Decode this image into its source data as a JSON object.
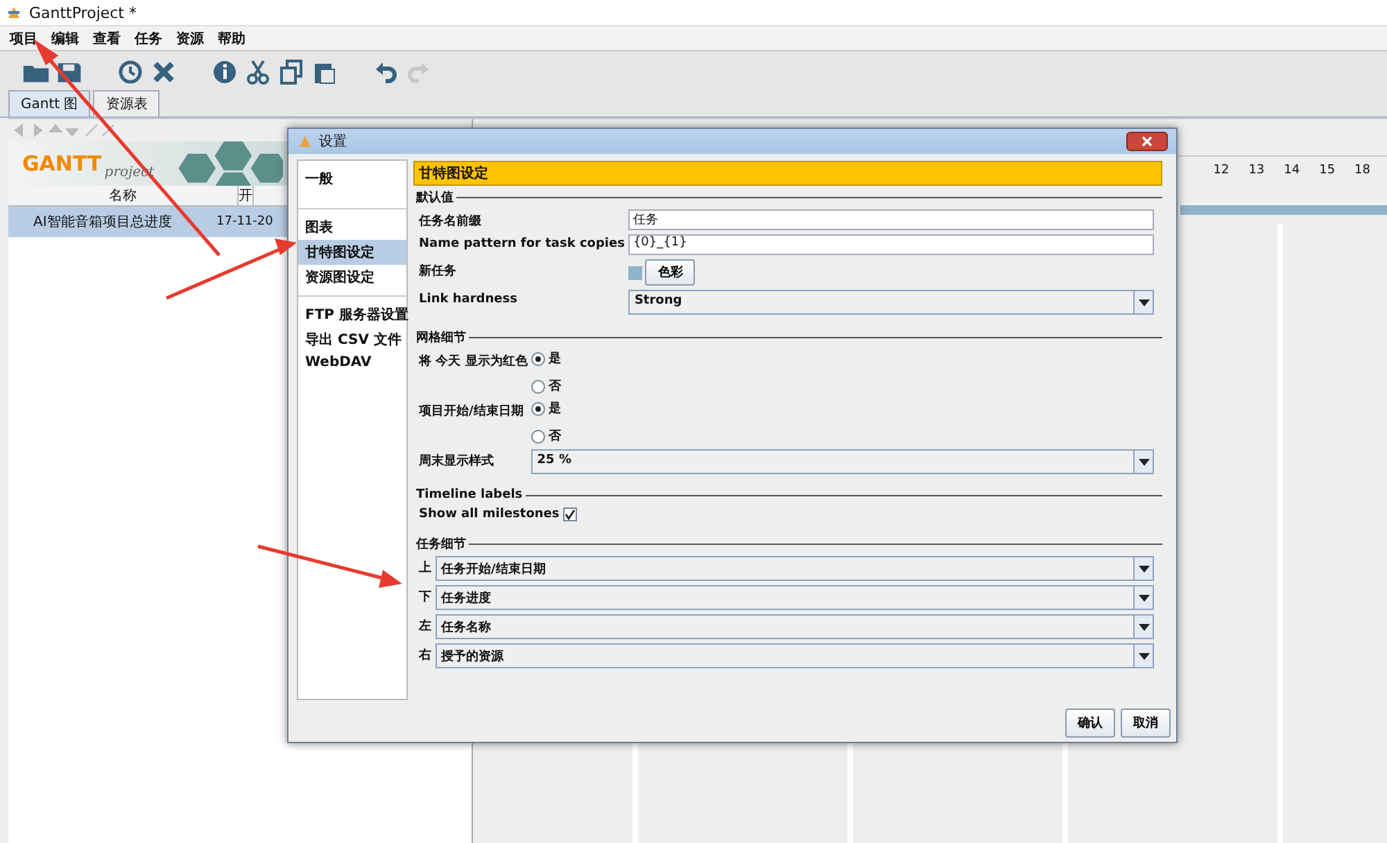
{
  "window": {
    "title": "GanttProject *"
  },
  "menu": [
    "项目",
    "编辑",
    "查看",
    "任务",
    "资源",
    "帮助"
  ],
  "tabs": [
    {
      "label": "Gantt 图",
      "selected": true
    },
    {
      "label": "资源表",
      "selected": false
    }
  ],
  "logo": {
    "title": "GANTT",
    "subtitle": "project"
  },
  "table": {
    "columns": [
      "名称",
      "开"
    ],
    "rows": [
      {
        "name": "AI智能音箱项目总进度",
        "start": "17-11-20",
        "selected": true
      }
    ]
  },
  "timeline": {
    "ticks": [
      "12",
      "13",
      "14",
      "15",
      "18"
    ]
  },
  "dialog": {
    "title": "设置",
    "nav": [
      [
        {
          "label": "一般",
          "selected": false
        }
      ],
      [
        {
          "label": "图表",
          "selected": false
        },
        {
          "label": "甘特图设定",
          "selected": true
        },
        {
          "label": "资源图设定",
          "selected": false
        }
      ],
      [
        {
          "label": "FTP 服务器设置",
          "selected": false
        },
        {
          "label": "导出 CSV 文件",
          "selected": false
        },
        {
          "label": "WebDAV",
          "selected": false
        }
      ]
    ],
    "header": "甘特图设定",
    "sections": [
      {
        "title": "默认值",
        "rows": [
          {
            "kind": "text",
            "label": "任务名前缀",
            "value": "任务"
          },
          {
            "kind": "text",
            "label": "Name pattern for task copies",
            "value": "{0}_{1}"
          },
          {
            "kind": "color",
            "label": "新任务",
            "button": "色彩"
          },
          {
            "kind": "select",
            "label": "Link hardness",
            "value": "Strong"
          }
        ]
      },
      {
        "title": "网格细节",
        "rows": [
          {
            "kind": "radio",
            "label": "将 今天 显示为红色",
            "options": [
              {
                "label": "是",
                "selected": true
              },
              {
                "label": "否",
                "selected": false
              }
            ]
          },
          {
            "kind": "radio",
            "label": "项目开始/结束日期",
            "options": [
              {
                "label": "是",
                "selected": true
              },
              {
                "label": "否",
                "selected": false
              }
            ]
          },
          {
            "kind": "select",
            "label": "周末显示样式",
            "value": "25 %"
          }
        ]
      },
      {
        "title": "Timeline labels",
        "rows": [
          {
            "kind": "checkbox",
            "label": "Show all milestones",
            "checked": true
          }
        ]
      },
      {
        "title": "任务细节",
        "rows": [
          {
            "kind": "select",
            "label": "上",
            "value": "任务开始/结束日期"
          },
          {
            "kind": "select",
            "label": "下",
            "value": "任务进度"
          },
          {
            "kind": "select",
            "label": "左",
            "value": "任务名称"
          },
          {
            "kind": "select",
            "label": "右",
            "value": "授予的资源"
          }
        ]
      }
    ],
    "buttons": [
      "确认",
      "取消"
    ]
  }
}
